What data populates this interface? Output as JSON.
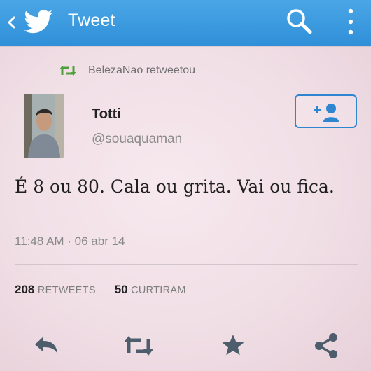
{
  "header": {
    "title": "Tweet",
    "back_icon": "chevron-left-icon",
    "logo_icon": "twitter-bird-icon",
    "search_icon": "search-icon",
    "menu_icon": "more-vertical-icon",
    "background_color": "#3f9de1"
  },
  "retweet_context": {
    "icon": "retweet-icon",
    "text": "BelezaNao retweetou",
    "icon_color": "#4fa03a"
  },
  "author": {
    "name": "Totti",
    "handle": "@souaquaman",
    "avatar": "profile-photo"
  },
  "follow_button": {
    "icon": "add-user-icon",
    "color": "#2f86d0"
  },
  "tweet": {
    "text": "É 8 ou 80. Cala ou grita. Vai ou fica.",
    "timestamp": "11:48 AM · 06 abr 14"
  },
  "stats": {
    "retweets_count": "208",
    "retweets_label": "RETWEETS",
    "likes_count": "50",
    "likes_label": "CURTIRAM"
  },
  "actions": [
    {
      "icon": "reply-icon"
    },
    {
      "icon": "retweet-icon"
    },
    {
      "icon": "star-icon"
    },
    {
      "icon": "share-icon"
    }
  ],
  "colors": {
    "action_icon": "#4d5d6c",
    "background": "#f1e0e7"
  }
}
